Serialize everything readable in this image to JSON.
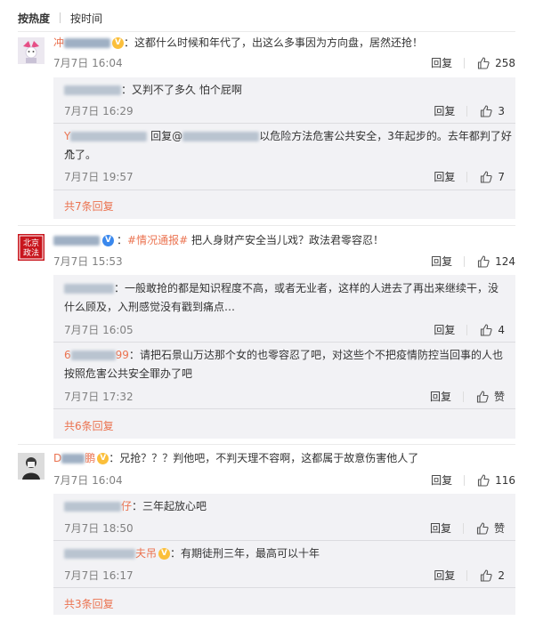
{
  "sort": {
    "hot": "按热度",
    "time": "按时间"
  },
  "ui": {
    "reply": "回复",
    "colon": "："
  },
  "colors": {
    "link": "#eb7350",
    "time": "#808080",
    "sub_bg": "#f2f2f5",
    "verified_blue": "#3a88ed"
  },
  "comments": [
    {
      "name_prefix": "冲",
      "text": "这都什么时候和年代了，出这么多事因为方向盘，居然还抢！",
      "time": "7月7日 16:04",
      "likes": "258",
      "replies": [
        {
          "text": "又判不了多久 怕个屁啊",
          "time": "7月7日 16:29",
          "likes": "3"
        },
        {
          "name_prefix": "Y",
          "reply_to": "回复@",
          "text_line1": "以危险方法危害公共安全，3年起步的。去年都判了好几",
          "text_line2": "个了。",
          "time": "7月7日 19:57",
          "likes": "7"
        }
      ],
      "more": "共7条回复"
    },
    {
      "avatar_text": "北京政法",
      "topic": "#情况通报#",
      "text": "把人身财产安全当儿戏？政法君零容忍！",
      "time": "7月7日 15:53",
      "likes": "124",
      "replies": [
        {
          "text_line1": "一般敢抢的都是知识程度不高，或者无业者，这样的人进去了再出来继续干，没",
          "text_line2": "什么顾及，入刑感觉没有戳到痛点…",
          "time": "7月7日 16:05",
          "likes": "4"
        },
        {
          "name_prefix": "6",
          "name_suffix": "99",
          "text_line1": "请把石景山万达那个女的也零容忍了吧，对这些个不把疫情防控当回事的人也",
          "text_line2": "按照危害公共安全罪办了吧",
          "time": "7月7日 17:32",
          "likes": "赞"
        }
      ],
      "more": "共6条回复"
    },
    {
      "name_prefix": "D",
      "name_suffix": "鹏",
      "text": "兄抢？？？判他吧，不判天理不容啊，这都属于故意伤害他人了",
      "time": "7月7日 16:04",
      "likes": "116",
      "replies": [
        {
          "name_suffix": "仔",
          "text": "三年起放心吧",
          "time": "7月7日 18:50",
          "likes": "赞"
        },
        {
          "name_suffix": "夫吊",
          "text": "有期徒刑三年，最高可以十年",
          "time": "7月7日 16:17",
          "likes": "2"
        }
      ],
      "more": "共3条回复"
    }
  ]
}
